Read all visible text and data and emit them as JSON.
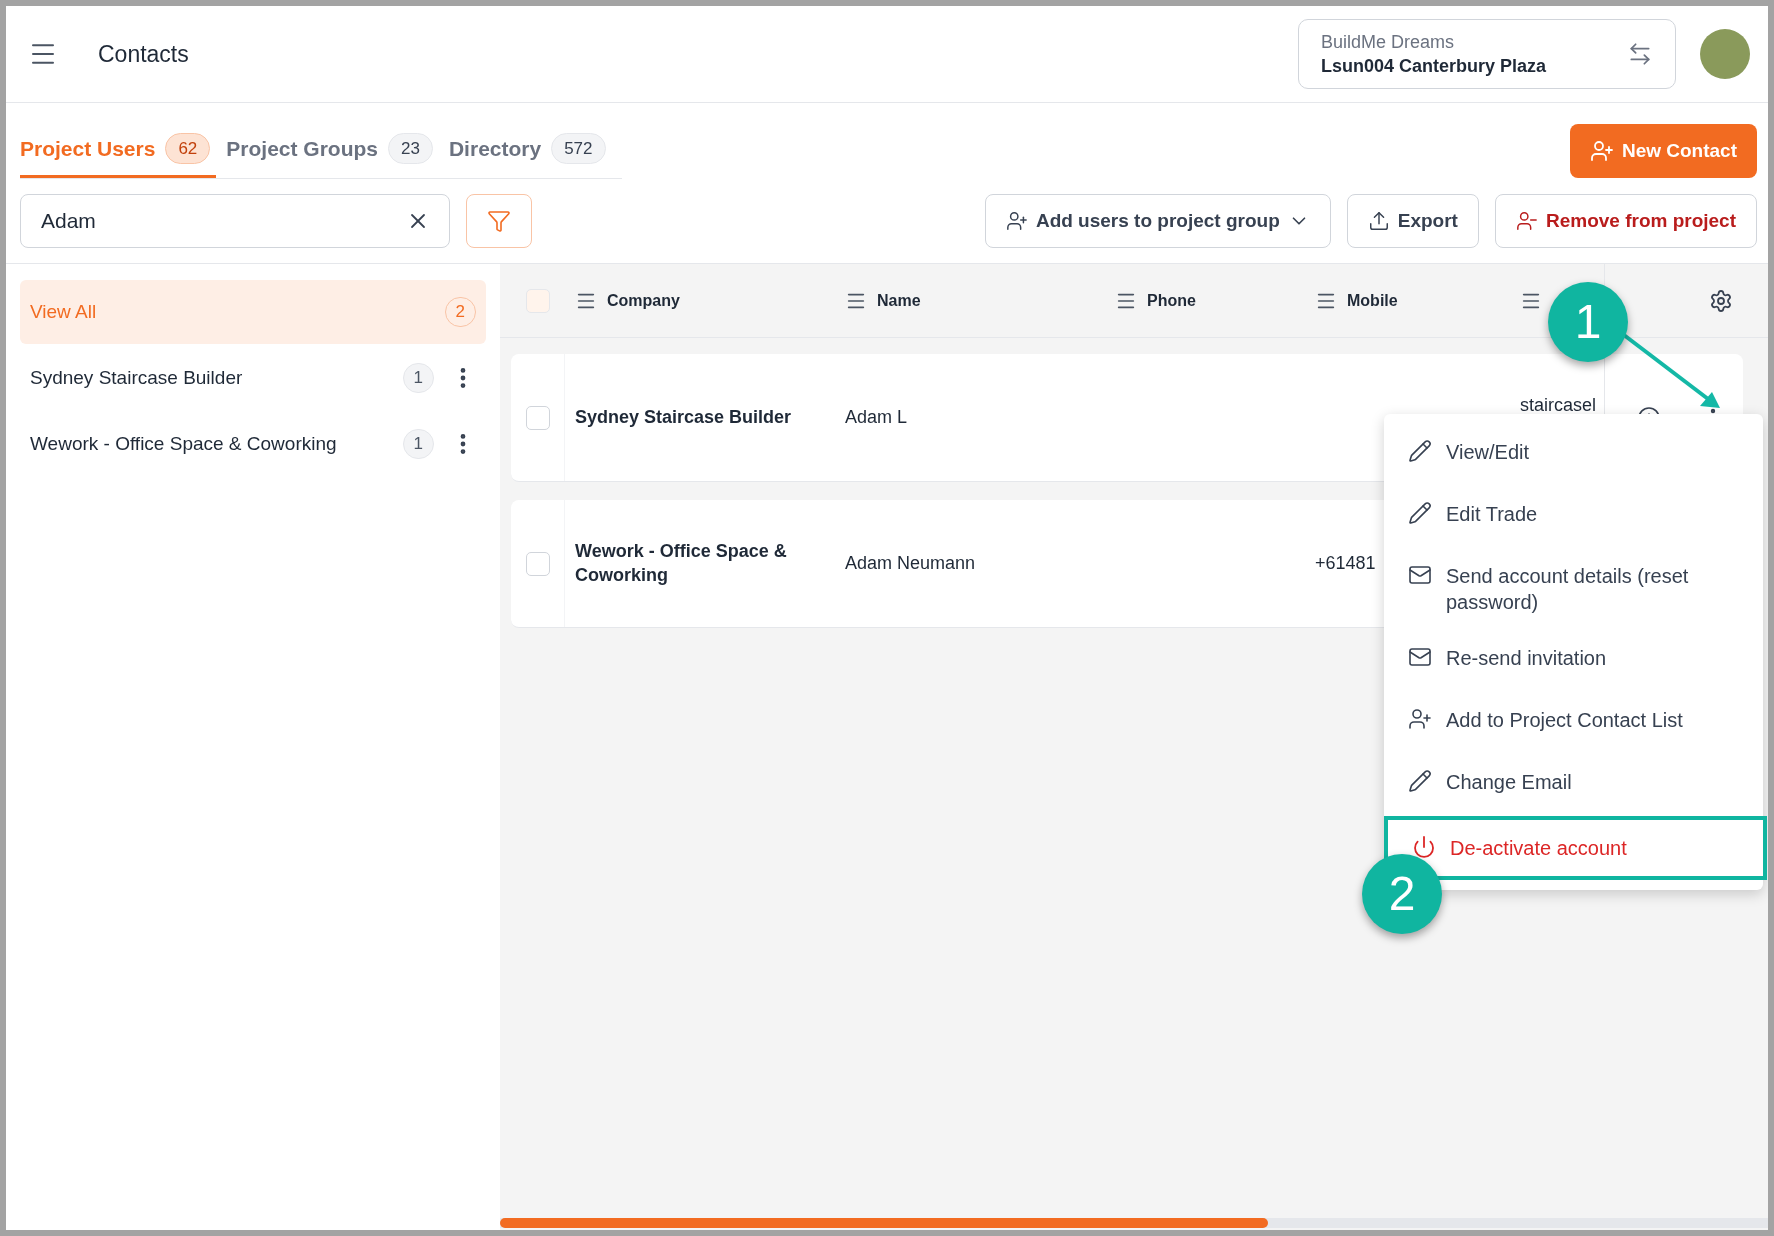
{
  "header": {
    "title": "Contacts",
    "org": {
      "name": "BuildMe Dreams",
      "project": "Lsun004 Canterbury Plaza"
    }
  },
  "tabs": [
    {
      "label": "Project Users",
      "count": "62",
      "selected": true
    },
    {
      "label": "Project Groups",
      "count": "23",
      "selected": false
    },
    {
      "label": "Directory",
      "count": "572",
      "selected": false
    }
  ],
  "new_contact": "New Contact",
  "search": {
    "value": "Adam"
  },
  "actions": [
    {
      "label": "Add users to project group",
      "kind": "dropdown"
    },
    {
      "label": "Export",
      "kind": "export"
    },
    {
      "label": "Remove from project",
      "kind": "danger"
    }
  ],
  "groups": [
    {
      "label": "View All",
      "count": "2",
      "selected": true
    },
    {
      "label": "Sydney Staircase Builder",
      "count": "1",
      "selected": false
    },
    {
      "label": "Wework - Office Space & Coworking",
      "count": "1",
      "selected": false
    }
  ],
  "table": {
    "columns": [
      "Company",
      "Name",
      "Phone",
      "Mobile"
    ],
    "select_all_checked": false,
    "rows": [
      {
        "company": "Sydney Staircase Builder",
        "name": "Adam L",
        "column_5": "staircasel",
        "checked": false,
        "menu": {
          "items": [
            {
              "label": "View/Edit",
              "kind": "pencil",
              "highlighted": false
            },
            {
              "label": "Edit Trade",
              "kind": "pencil",
              "highlighted": false
            },
            {
              "label": "Send account details (reset password)",
              "kind": "mail",
              "highlighted": false
            },
            {
              "label": "Re-send invitation",
              "kind": "mail",
              "highlighted": false
            },
            {
              "label": "Add to Project Contact List",
              "kind": "user-plus",
              "highlighted": false
            },
            {
              "label": "Change Email",
              "kind": "pencil",
              "highlighted": false
            },
            {
              "label": "De-activate account",
              "kind": "power",
              "highlighted": true
            }
          ]
        }
      },
      {
        "company": "Wework - Office Space & Coworking",
        "name": "Adam Neumann",
        "mobile": "+61481",
        "checked": false
      }
    ]
  },
  "annotations": [
    {
      "label": "1"
    },
    {
      "label": "2"
    }
  ]
}
